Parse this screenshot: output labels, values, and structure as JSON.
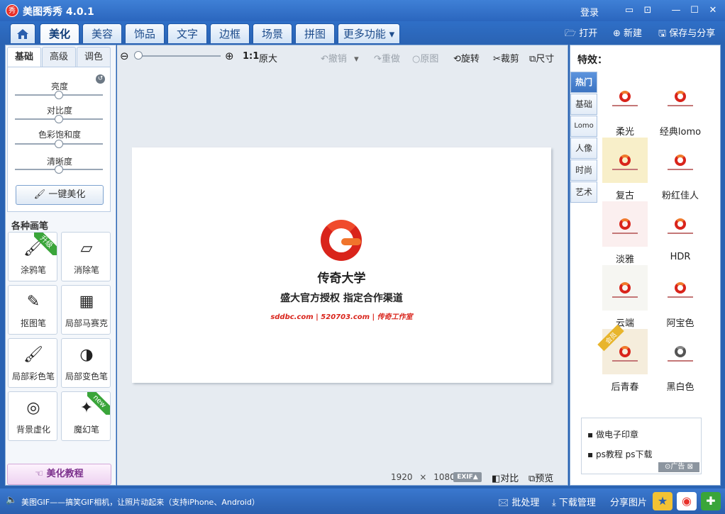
{
  "window": {
    "logo_text": "秀",
    "title": "美图秀秀 4.0.1",
    "login": "登录",
    "controls": [
      "▭",
      "⊡",
      "—",
      "☐",
      "✕"
    ]
  },
  "menu": {
    "tabs": [
      "美化",
      "美容",
      "饰品",
      "文字",
      "边框",
      "场景",
      "拼图",
      "更多功能 ▾"
    ],
    "actions": [
      "打开",
      "新建",
      "保存与分享"
    ]
  },
  "adjust": {
    "tabs": [
      "基础",
      "高级",
      "调色"
    ],
    "sliders": [
      "亮度",
      "对比度",
      "色彩饱和度",
      "清晰度"
    ],
    "auto_button": "一键美化"
  },
  "brushes": {
    "title": "各种画笔",
    "items": [
      {
        "label": "涂鸦笔",
        "icon": "🖌",
        "ribbon": "升级",
        "ribbon_color": "#3aa53a"
      },
      {
        "label": "消除笔",
        "icon": "▱",
        "ribbon": "",
        "ribbon_color": ""
      },
      {
        "label": "抠图笔",
        "icon": "✎",
        "ribbon": "",
        "ribbon_color": ""
      },
      {
        "label": "局部马赛克",
        "icon": "▦",
        "ribbon": "",
        "ribbon_color": ""
      },
      {
        "label": "局部彩色笔",
        "icon": "🖌",
        "ribbon": "",
        "ribbon_color": ""
      },
      {
        "label": "局部变色笔",
        "icon": "◑",
        "ribbon": "",
        "ribbon_color": ""
      },
      {
        "label": "背景虚化",
        "icon": "◎",
        "ribbon": "",
        "ribbon_color": ""
      },
      {
        "label": "魔幻笔",
        "icon": "✦",
        "ribbon": "new",
        "ribbon_color": "#3aa53a"
      }
    ],
    "tutorial": "美化教程"
  },
  "toolbar": {
    "zoom_ratio": "1:1",
    "original_size": "原大",
    "undo": "撤销",
    "redo": "重做",
    "original": "原图",
    "rotate": "旋转",
    "crop": "裁剪",
    "resize": "尺寸"
  },
  "canvas": {
    "name_line": "传奇大学",
    "slogan": "盛大官方授权   指定合作渠道",
    "links": "sddbc.com  |  520703.com  |  传奇工作室"
  },
  "image_info": {
    "width": "1920",
    "times": "×",
    "height": "1080",
    "exif": "EXIF▲",
    "compare": "对比",
    "preview": "预览"
  },
  "effects": {
    "title": "特效：",
    "categories": [
      "热门",
      "基础",
      "Lomo",
      "人像",
      "时尚",
      "艺术"
    ],
    "items": [
      {
        "label": "柔光",
        "bg": "#ffffff",
        "ribbon": ""
      },
      {
        "label": "经典lomo",
        "bg": "#ffffff",
        "ribbon": ""
      },
      {
        "label": "复古",
        "bg": "#f8efc9",
        "ribbon": ""
      },
      {
        "label": "粉红佳人",
        "bg": "#ffffff",
        "ribbon": ""
      },
      {
        "label": "淡雅",
        "bg": "#fbefef",
        "ribbon": ""
      },
      {
        "label": "HDR",
        "bg": "#ffffff",
        "ribbon": ""
      },
      {
        "label": "云端",
        "bg": "#f6f6f2",
        "ribbon": ""
      },
      {
        "label": "阿宝色",
        "bg": "#ffffff",
        "ribbon": ""
      },
      {
        "label": "后青春",
        "bg": "#f5eddc",
        "ribbon": "会员"
      },
      {
        "label": "黑白色",
        "bg": "#ffffff",
        "ribbon": ""
      }
    ]
  },
  "ad": {
    "items": [
      "做电子印章",
      "ps教程    ps下载"
    ],
    "label": "⊙广告 ⊠"
  },
  "status": {
    "speaker": "🔈",
    "message": "美图GIF——搞笑GIF相机，让照片动起来（支持iPhone、Android）",
    "batch": "批处理",
    "download": "下载管理",
    "share": "分享图片"
  }
}
